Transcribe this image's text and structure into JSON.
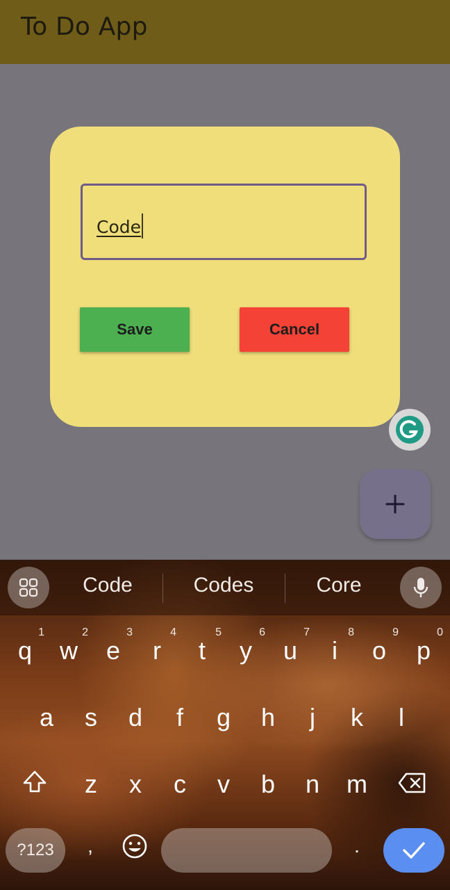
{
  "app": {
    "title": "To Do App"
  },
  "dialog": {
    "task_input_value": "Code",
    "save_label": "Save",
    "cancel_label": "Cancel"
  },
  "fab": {
    "icon": "plus-icon"
  },
  "keyboard": {
    "suggestions": [
      "Code",
      "Codes",
      "Core"
    ],
    "row1": [
      {
        "key": "q",
        "hint": "1"
      },
      {
        "key": "w",
        "hint": "2"
      },
      {
        "key": "e",
        "hint": "3"
      },
      {
        "key": "r",
        "hint": "4"
      },
      {
        "key": "t",
        "hint": "5"
      },
      {
        "key": "y",
        "hint": "6"
      },
      {
        "key": "u",
        "hint": "7"
      },
      {
        "key": "i",
        "hint": "8"
      },
      {
        "key": "o",
        "hint": "9"
      },
      {
        "key": "p",
        "hint": "0"
      }
    ],
    "row2": [
      "a",
      "s",
      "d",
      "f",
      "g",
      "h",
      "j",
      "k",
      "l"
    ],
    "row3": [
      "z",
      "x",
      "c",
      "v",
      "b",
      "n",
      "m"
    ],
    "symbols_label": "?123",
    "comma_label": ",",
    "period_label": "."
  },
  "colors": {
    "appbar": "#6f5c18",
    "dialog": "#efde7a",
    "save": "#4caf50",
    "cancel": "#f44336",
    "enter": "#5a8ef0"
  }
}
